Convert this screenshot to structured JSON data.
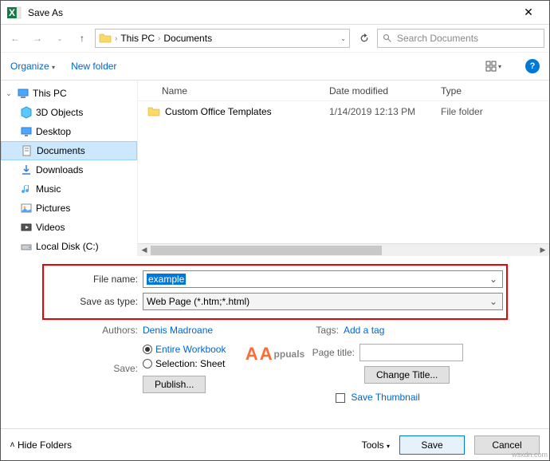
{
  "title": "Save As",
  "breadcrumb": {
    "part1": "This PC",
    "part2": "Documents"
  },
  "search_placeholder": "Search Documents",
  "toolbar": {
    "organize": "Organize",
    "new_folder": "New folder"
  },
  "tree": {
    "root": "This PC",
    "items": [
      {
        "label": "3D Objects"
      },
      {
        "label": "Desktop"
      },
      {
        "label": "Documents"
      },
      {
        "label": "Downloads"
      },
      {
        "label": "Music"
      },
      {
        "label": "Pictures"
      },
      {
        "label": "Videos"
      },
      {
        "label": "Local Disk (C:)"
      }
    ]
  },
  "columns": {
    "name": "Name",
    "date": "Date modified",
    "type": "Type"
  },
  "rows": [
    {
      "name": "Custom Office Templates",
      "date": "1/14/2019 12:13 PM",
      "type": "File folder"
    }
  ],
  "form": {
    "filename_label": "File name:",
    "filename_value": "example",
    "type_label": "Save as type:",
    "type_value": "Web Page (*.htm;*.html)",
    "authors_label": "Authors:",
    "authors_value": "Denis Madroane",
    "tags_label": "Tags:",
    "tags_value": "Add a tag",
    "save_label": "Save:",
    "radio_workbook": "Entire Workbook",
    "radio_selection": "Selection: Sheet",
    "publish_btn": "Publish...",
    "page_title_label": "Page title:",
    "change_title_btn": "Change Title...",
    "save_thumbnail": "Save Thumbnail"
  },
  "footer": {
    "hide_folders": "Hide Folders",
    "tools": "Tools",
    "save": "Save",
    "cancel": "Cancel"
  },
  "watermark": "ppuals",
  "credit": "wsxdn.com"
}
